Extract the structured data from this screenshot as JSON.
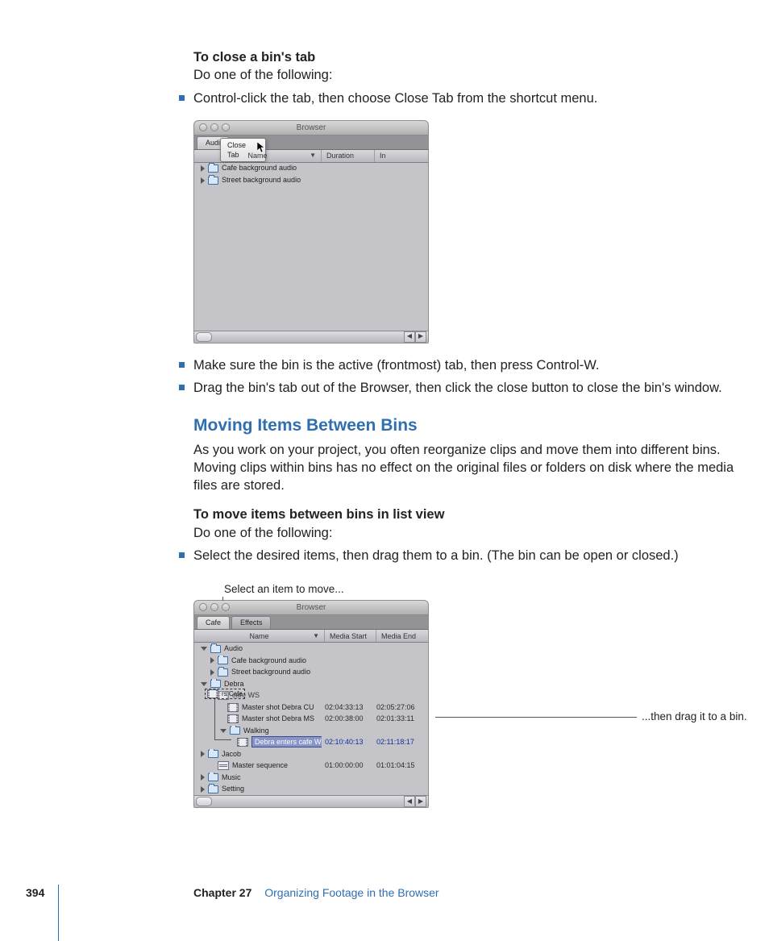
{
  "intro": {
    "h1": "To close a bin's tab",
    "sub": "Do one of the following:"
  },
  "bullets_a": [
    "Control-click the tab, then choose Close Tab from the shortcut menu."
  ],
  "win1": {
    "title": "Browser",
    "tab": "Audi",
    "menu": "Close Tab",
    "cols": {
      "name": "Name",
      "c2": "Duration",
      "c3": "In"
    },
    "rows": [
      {
        "name": "Cafe background audio"
      },
      {
        "name": "Street background audio"
      }
    ]
  },
  "bullets_b": [
    "Make sure the bin is the active (frontmost) tab, then press Control-W.",
    "Drag the bin's tab out of the Browser, then click the close button to close the bin's window."
  ],
  "section2": {
    "title": "Moving Items Between Bins",
    "para": "As you work on your project, you often reorganize clips and move them into different bins. Moving clips within bins has no effect on the original files or folders on disk where the media files are stored.",
    "h2": "To move items between bins in list view",
    "sub": "Do one of the following:"
  },
  "bullets_c": [
    "Select the desired items, then drag them to a bin. (The bin can be open or closed.)"
  ],
  "callouts": {
    "top": "Select an item to move...",
    "right": "...then drag it to a bin."
  },
  "win2": {
    "title": "Browser",
    "tabs": [
      "Cafe",
      "Effects"
    ],
    "cols": {
      "name": "Name",
      "c2": "Media Start",
      "c3": "Media End"
    },
    "drag_ghost": "rs Cafe",
    "rows": [
      {
        "type": "bin-open",
        "name": "Audio",
        "d": 0
      },
      {
        "type": "bin",
        "name": "Cafe background audio",
        "d": 1
      },
      {
        "type": "bin",
        "name": "Street background audio",
        "d": 1
      },
      {
        "type": "bin-open",
        "name": "Debra",
        "d": 0
      },
      {
        "type": "clip",
        "name": "cafe WS",
        "d": 1,
        "ghost": true
      },
      {
        "type": "clip",
        "name": "Master shot Debra CU",
        "d": 2,
        "c2": "02:04:33:13",
        "c3": "02:05:27:06"
      },
      {
        "type": "clip",
        "name": "Master shot Debra MS",
        "d": 2,
        "c2": "02:00:38:00",
        "c3": "02:01:33:11"
      },
      {
        "type": "bin-open",
        "name": "Walking",
        "d": 2
      },
      {
        "type": "clip-sel",
        "name": "Debra enters cafe WS",
        "d": 3,
        "c2": "02:10:40:13",
        "c3": "02:11:18:17"
      },
      {
        "type": "bin",
        "name": "Jacob",
        "d": 0
      },
      {
        "type": "seq",
        "name": "Master sequence",
        "d": 1,
        "c2": "01:00:00:00",
        "c3": "01:01:04:15"
      },
      {
        "type": "bin",
        "name": "Music",
        "d": 0
      },
      {
        "type": "bin",
        "name": "Setting",
        "d": 0
      }
    ]
  },
  "footer": {
    "page": "394",
    "chapter": "Chapter 27",
    "title": "Organizing Footage in the Browser"
  }
}
